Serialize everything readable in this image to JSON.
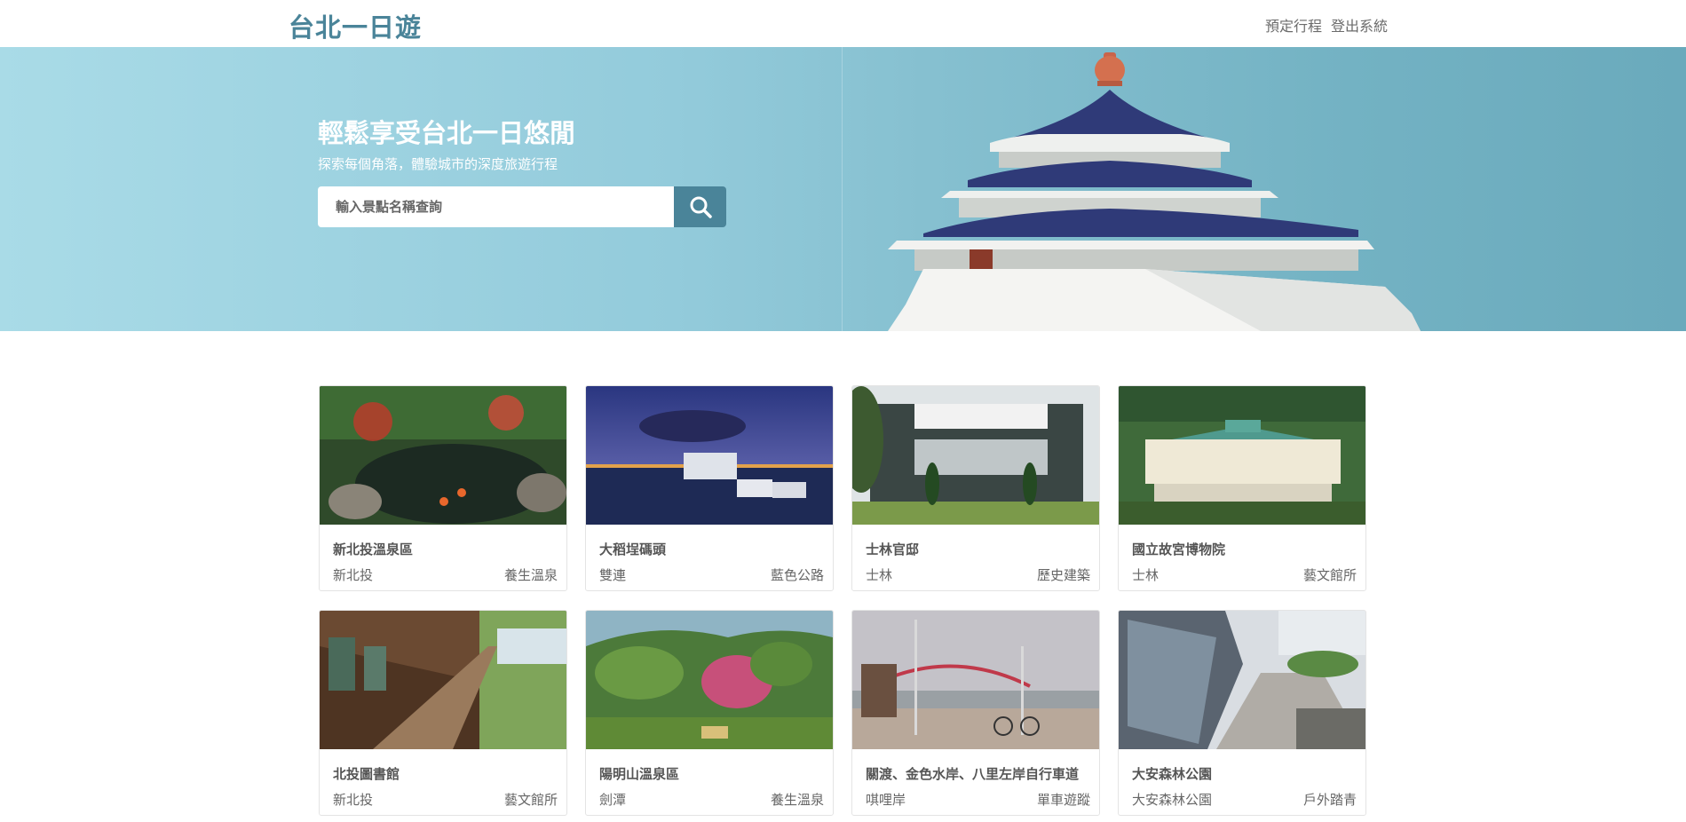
{
  "header": {
    "logo": "台北一日遊",
    "nav": [
      {
        "label": "預定行程"
      },
      {
        "label": "登出系統"
      }
    ]
  },
  "hero": {
    "title": "輕鬆享受台北一日悠閒",
    "subtitle": "探索每個角落，體驗城市的深度旅遊行程",
    "search_placeholder": "輸入景點名稱查詢",
    "search_icon": "search-icon"
  },
  "attractions": [
    {
      "name": "新北投溫泉區",
      "district": "新北投",
      "category": "養生溫泉"
    },
    {
      "name": "大稻埕碼頭",
      "district": "雙連",
      "category": "藍色公路"
    },
    {
      "name": "士林官邸",
      "district": "士林",
      "category": "歷史建築"
    },
    {
      "name": "國立故宮博物院",
      "district": "士林",
      "category": "藝文館所"
    },
    {
      "name": "北投圖書館",
      "district": "新北投",
      "category": "藝文館所"
    },
    {
      "name": "陽明山溫泉區",
      "district": "劍潭",
      "category": "養生溫泉"
    },
    {
      "name": "關渡、金色水岸、八里左岸自行車道",
      "district": "唭哩岸",
      "category": "單車遊蹤"
    },
    {
      "name": "大安森林公園",
      "district": "大安森林公園",
      "category": "戶外踏青"
    }
  ],
  "colors": {
    "brand": "#4a8499",
    "hero_left": "#a9dbe7",
    "hero_right": "#6aaabc"
  }
}
